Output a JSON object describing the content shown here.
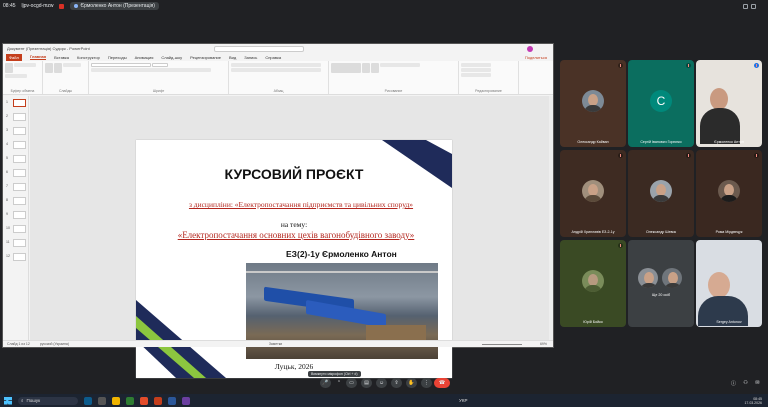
{
  "browser": {
    "time": "08:45",
    "code": "ljpv-ocgd-mzw",
    "sharing": "Єрмоленко Антон (Презентація)"
  },
  "ppt": {
    "window_title": "Документ (Презентація) Судорк - PowerPoint",
    "menu": [
      "Файл",
      "Главная",
      "Вставка",
      "Конструктор",
      "Переходы",
      "Анимация",
      "Слайд-шоу",
      "Рецензирование",
      "Вид",
      "Запись",
      "Справка"
    ],
    "active_menu": "Главная",
    "publish": "Поделиться",
    "groups": [
      "Буфер обмена",
      "Слайды",
      "Шрифт",
      "Абзац",
      "Рисование",
      "Редактирование"
    ],
    "slide_numbers": [
      "1",
      "2",
      "3",
      "4",
      "5",
      "6",
      "7",
      "8",
      "9",
      "10",
      "11",
      "12"
    ],
    "status_left": "Слайд 1 из 12",
    "status_lang": "русский (Украина)",
    "status_notes": "Заметки",
    "zoom": "69%"
  },
  "slide": {
    "title": "КУРСОВИЙ ПРОЄКТ",
    "subject": "з дисципліни: «Електропостачання підприємств та цивільних споруд»",
    "on_topic": "на тему:",
    "topic": "«Електропостачання основних цехів вагонобудівного заводу»",
    "author": "ЕЗ(2)-1у   Єрмоленко Антон",
    "city": "Луцьк, 2026"
  },
  "participants": [
    {
      "name": "Олександр Кайван",
      "kind": "photo"
    },
    {
      "name": "Сергій Іванович Горюнко",
      "kind": "letter",
      "letter": "С"
    },
    {
      "name": "Єрмоленко Антон",
      "kind": "video"
    },
    {
      "name": "Андрій Хрипливів ЕЗ-2-1у",
      "kind": "photo"
    },
    {
      "name": "Олександр Шевок",
      "kind": "photo"
    },
    {
      "name": "Рома Мірдвецук",
      "kind": "photo"
    },
    {
      "name": "Юрій Бойко",
      "kind": "photo"
    },
    {
      "name": "Ще 20 осіб",
      "kind": "group"
    },
    {
      "name": "Sergey Antonov",
      "kind": "video"
    }
  ],
  "meet_hint": "Вимкнути мікрофон (Ctrl + d)",
  "taskbar": {
    "search": "Пошук",
    "lang": "УКР",
    "time": "08:45",
    "date": "17.03.2026"
  },
  "colors": {
    "ppt_accent": "#c43e1c",
    "slide_navy": "#1f2b5a",
    "slide_green": "#8cc63f",
    "tile_bg": "#3c2a22",
    "end_call": "#ea4335"
  }
}
